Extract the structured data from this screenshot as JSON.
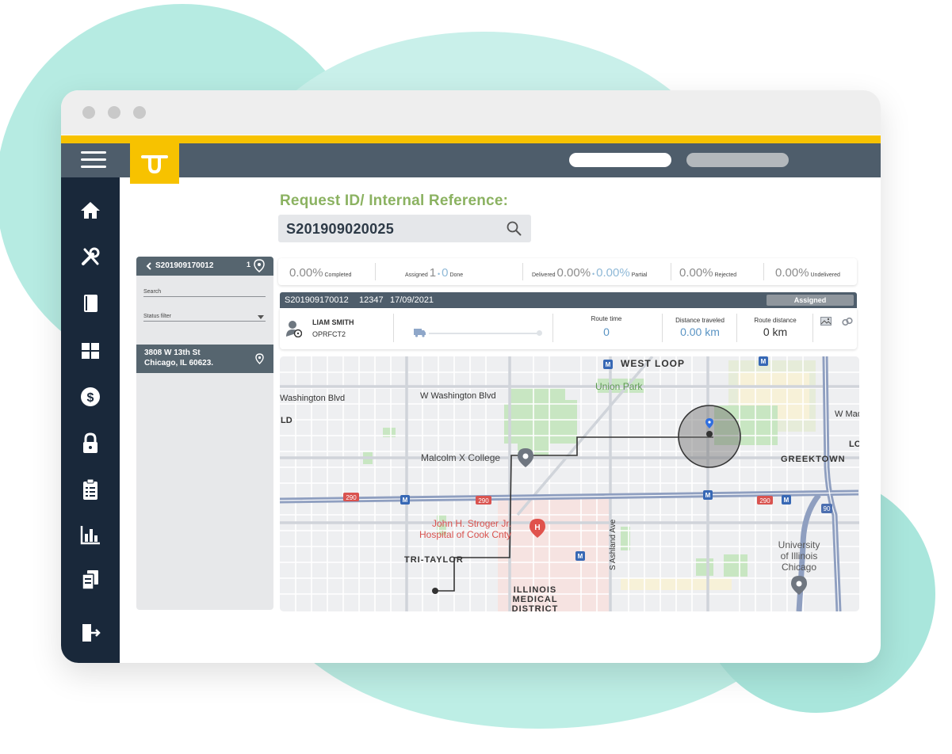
{
  "logo": {
    "glyph": "ᴛᴜ"
  },
  "search": {
    "label": "Request ID/ Internal Reference:",
    "value": "S201909020025"
  },
  "left_panel": {
    "header_id": "S201909170012",
    "header_count": "1",
    "search_label": "Search",
    "status_filter_label": "Status filter",
    "item": {
      "line1": "3808 W 13th St",
      "line2": "Chicago, IL 60623."
    }
  },
  "stats": {
    "completed": {
      "value": "0.00%",
      "label": "Completed"
    },
    "assigned": {
      "label": "Assigned",
      "value": "1",
      "sep": "•",
      "done_value": "0",
      "done_label": "Done"
    },
    "delivered": {
      "label": "Delivered",
      "value": "0.00%",
      "sep": "•",
      "partial_value": "0.00%",
      "partial_label": "Partial"
    },
    "rejected": {
      "value": "0.00%",
      "label": "Rejected"
    },
    "undelivered": {
      "value": "0.00%",
      "label": "Undelivered"
    }
  },
  "order": {
    "id": "S201909170012",
    "code": "12347",
    "date": "17/09/2021",
    "status": "Assigned",
    "driver_name": "LIAM SMITH",
    "driver_code": "OPRFCT2",
    "route_time_label": "Route time",
    "route_time_value": "0",
    "distance_traveled_label": "Distance traveled",
    "distance_traveled_value": "0.00 km",
    "route_distance_label": "Route distance",
    "route_distance_value": "0 km"
  },
  "map": {
    "labels": {
      "west_loop": "WEST LOOP",
      "union_park": "Union Park",
      "washington_blvd_1": "Washington Blvd",
      "washington_blvd_2": "W Washington Blvd",
      "ld": "LD",
      "w_mad": "W Mad",
      "lo": "LO",
      "malcolm_x": "Malcolm X College",
      "greektown": "GREEKTOWN",
      "hospital_1": "John H. Stroger Jr.",
      "hospital_2": "Hospital of Cook Cnty",
      "s_ashland": "S Ashland Ave",
      "uic_1": "University",
      "uic_2": "of Illinois",
      "uic_3": "Chicago",
      "tri_taylor": "TRI-TAYLOR",
      "illinois_1": "ILLINOIS",
      "illinois_2": "MEDICAL",
      "illinois_3": "DISTRICT",
      "i290": "290",
      "i90": "90",
      "metro": "M",
      "hospital_glyph": "H"
    }
  },
  "colors": {
    "accent_yellow": "#f7c200",
    "nav_gray": "#4e5d6b",
    "sidebar_navy": "#19283a",
    "label_green": "#8bb261",
    "highway_blue": "#8f9fc0"
  }
}
